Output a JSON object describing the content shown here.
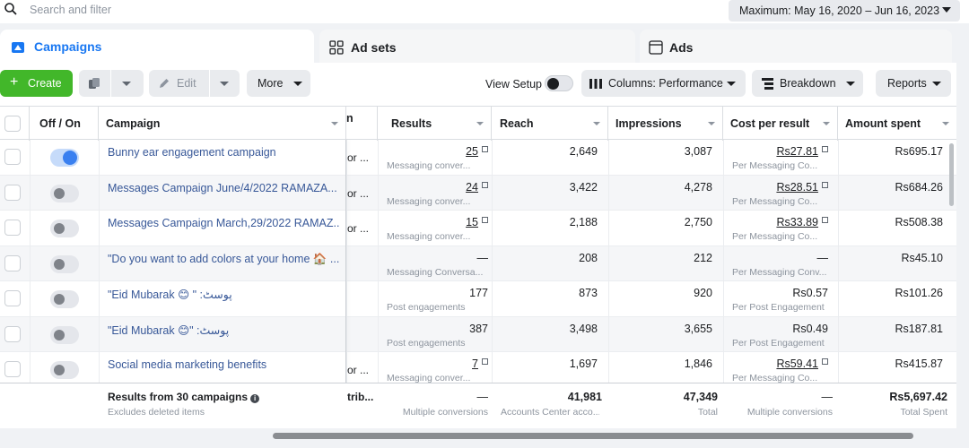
{
  "search": {
    "placeholder": "Search and filter"
  },
  "date_range": {
    "label": "Maximum: May 16, 2020 – Jun 16, 2023"
  },
  "tabs": [
    {
      "label": "Campaigns",
      "icon": "campaign-folder-icon",
      "active": true
    },
    {
      "label": "Ad sets",
      "icon": "ad-sets-grid-icon",
      "active": false
    },
    {
      "label": "Ads",
      "icon": "ads-square-icon",
      "active": false
    }
  ],
  "toolbar": {
    "create": "Create",
    "edit": "Edit",
    "more": "More",
    "view_setup": "View Setup",
    "columns": "Columns: Performance",
    "breakdown": "Breakdown",
    "reports": "Reports"
  },
  "colors": {
    "accent": "#1877f2",
    "create_green": "#42b72a",
    "link": "#385898"
  },
  "columns": {
    "off_on": "Off / On",
    "campaign": "Campaign",
    "delivery_fragment": "n",
    "results": "Results",
    "reach": "Reach",
    "impressions": "Impressions",
    "cost_per_result": "Cost per result",
    "amount_spent": "Amount spent"
  },
  "rows": [
    {
      "on": true,
      "name": "Bunny ear engagement campaign",
      "delivery": "or ...",
      "results": "25",
      "results_sub": "Messaging conver...",
      "reach": "2,649",
      "impressions": "3,087",
      "cpr": "Rs27.81",
      "cpr_sub": "Per Messaging Co...",
      "spent": "Rs695.17"
    },
    {
      "on": false,
      "name": "Messages Campaign June/4/2022 RAMAZA...",
      "delivery": "or ...",
      "results": "24",
      "results_sub": "Messaging conver...",
      "reach": "3,422",
      "impressions": "4,278",
      "cpr": "Rs28.51",
      "cpr_sub": "Per Messaging Co...",
      "spent": "Rs684.26"
    },
    {
      "on": false,
      "name": "Messages Campaign March,29/2022 RAMAZ...",
      "delivery": "or ...",
      "results": "15",
      "results_sub": "Messaging conver...",
      "reach": "2,188",
      "impressions": "2,750",
      "cpr": "Rs33.89",
      "cpr_sub": "Per Messaging Co...",
      "spent": "Rs508.38"
    },
    {
      "on": false,
      "name": "\"Do you want to add colors at your home 🏠 ....",
      "delivery": "",
      "results": "—",
      "results_sub": "Messaging Conversa...",
      "reach": "208",
      "impressions": "212",
      "cpr": "—",
      "cpr_sub": "Per Messaging Conv...",
      "spent": "Rs45.10"
    },
    {
      "on": false,
      "name": "\"Eid Mubarak 😊 \" :پوسٹ",
      "delivery": "",
      "results": "177",
      "results_sub": "Post engagements",
      "reach": "873",
      "impressions": "920",
      "cpr": "Rs0.57",
      "cpr_sub": "Per Post Engagement",
      "spent": "Rs101.26"
    },
    {
      "on": false,
      "name": "\"Eid Mubarak 😊\" :پوسٹ",
      "delivery": "",
      "results": "387",
      "results_sub": "Post engagements",
      "reach": "3,498",
      "impressions": "3,655",
      "cpr": "Rs0.49",
      "cpr_sub": "Per Post Engagement",
      "spent": "Rs187.81"
    },
    {
      "on": false,
      "name": "Social media marketing benefits",
      "delivery": "or ...",
      "results": "7",
      "results_sub": "Messaging conver...",
      "reach": "1,697",
      "impressions": "1,846",
      "cpr": "Rs59.41",
      "cpr_sub": "Per Messaging Co...",
      "spent": "Rs415.87"
    }
  ],
  "footer": {
    "title": "Results from 30 campaigns",
    "subtitle": "Excludes deleted items",
    "delivery": "trib...",
    "results": "—",
    "results_sub": "Multiple conversions",
    "reach": "41,981",
    "reach_sub": "Accounts Center acco...",
    "impressions": "47,349",
    "impressions_sub": "Total",
    "cpr": "—",
    "cpr_sub": "Multiple conversions",
    "spent": "Rs5,697.42",
    "spent_sub": "Total Spent"
  }
}
